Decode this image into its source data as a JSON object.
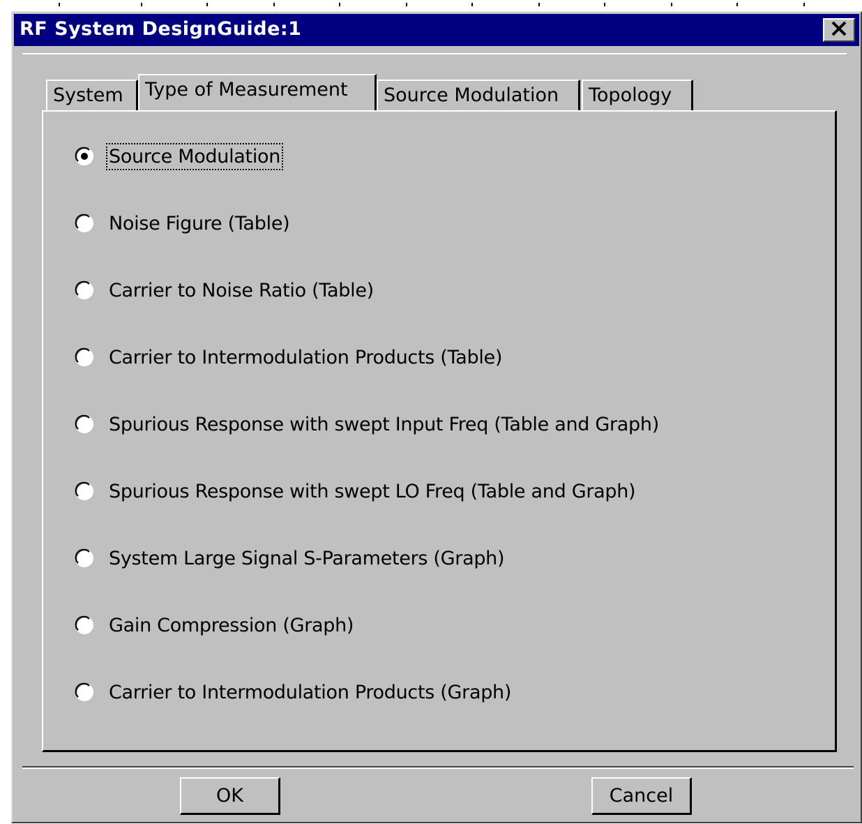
{
  "window": {
    "title": "RF System DesignGuide:1",
    "close_symbol": "✕"
  },
  "tabs": [
    {
      "label": "System",
      "active": false
    },
    {
      "label": "Type of Measurement",
      "active": true
    },
    {
      "label": "Source Modulation",
      "active": false
    },
    {
      "label": "Topology",
      "active": false
    }
  ],
  "measurement_options": [
    {
      "label": "Source Modulation",
      "selected": true
    },
    {
      "label": "Noise Figure (Table)",
      "selected": false
    },
    {
      "label": "Carrier to Noise Ratio  (Table)",
      "selected": false
    },
    {
      "label": "Carrier to Intermodulation Products (Table)",
      "selected": false
    },
    {
      "label": "Spurious Response with swept Input Freq (Table and Graph)",
      "selected": false
    },
    {
      "label": "Spurious Response with swept LO Freq (Table and Graph)",
      "selected": false
    },
    {
      "label": "System Large Signal S-Parameters (Graph)",
      "selected": false
    },
    {
      "label": "Gain Compression  (Graph)",
      "selected": false
    },
    {
      "label": "Carrier to Intermodulation Products (Graph)",
      "selected": false
    }
  ],
  "buttons": {
    "ok": "OK",
    "cancel": "Cancel"
  },
  "colors": {
    "titlebar": "#000080",
    "face": "#c0c0c0"
  }
}
